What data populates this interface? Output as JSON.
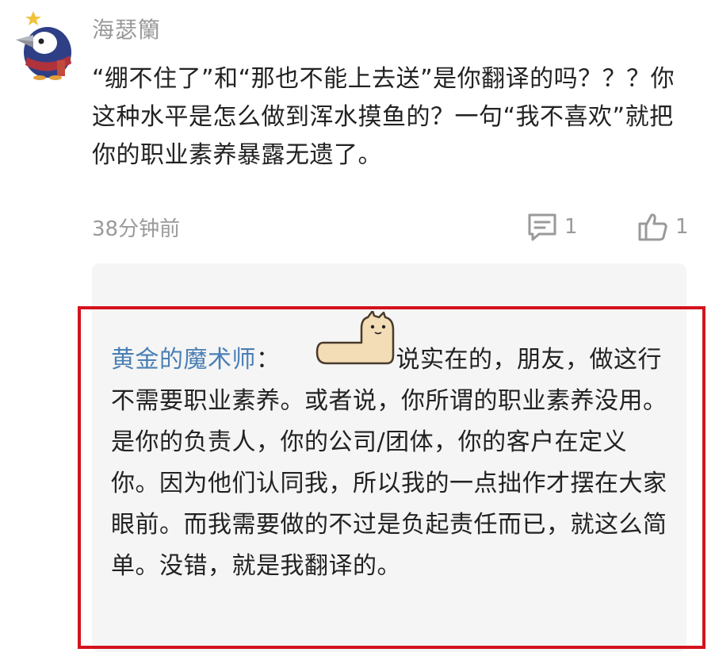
{
  "comment": {
    "username": "海瑟籣",
    "text": "“绷不住了”和“那也不能上去送”是你翻译的吗？？？你这种水平是怎么做到浑水摸鱼的？一句“我不喜欢”就把你的职业素养暴露无遗了。",
    "timestamp": "38分钟前",
    "reply_count": "1",
    "like_count": "1"
  },
  "reply": {
    "author": "黄金的魔术师",
    "colon": "：",
    "text": "说实在的，朋友，做这行不需要职业素养。或者说，你所谓的职业素养没用。是你的负责人，你的公司/团体，你的客户在定义你。因为他们认同我，所以我的一点拙作才摆在大家眼前。而我需要做的不过是负起责任而已，就这么简单。没错，就是我翻译的。"
  },
  "colors": {
    "username_gray": "#9a9a9a",
    "text_dark": "#222222",
    "reply_author_blue": "#4a7fb5",
    "reply_bg": "#f5f5f5",
    "highlight_red": "#d3131d"
  },
  "icons": {
    "avatar": "penguin-avatar-icon",
    "reply": "comment-icon",
    "like": "thumbs-up-icon",
    "sticker": "cat-sticker-icon"
  }
}
